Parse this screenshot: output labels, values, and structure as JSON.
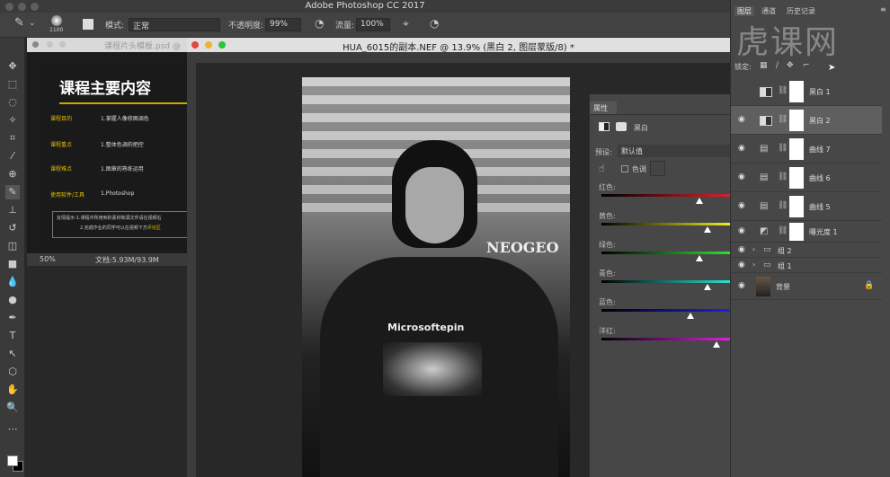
{
  "app": {
    "title": "Adobe Photoshop CC 2017"
  },
  "options": {
    "brush_size": "1100",
    "mode_label": "模式:",
    "mode_value": "正常",
    "opacity_label": "不透明度:",
    "opacity_value": "99%",
    "flow_label": "流量:",
    "flow_value": "100%"
  },
  "doc1": {
    "tab": "课程片头模板.psd @",
    "heading": "课程主要内容",
    "rows": [
      {
        "label": "课程目的",
        "value": "1.掌握人像修图调色"
      },
      {
        "label": "课程重点",
        "value": "1.整体色调的把控"
      },
      {
        "label": "课程难点",
        "value": "1.图章的熟练运用"
      },
      {
        "label": "使用软件/工具",
        "value": "1.Photoshop"
      }
    ],
    "tip1": "友情提示-1.课程中所用到的素材和源文件请在视频右",
    "tip2": "2.完成作业的同学可以在视频下方",
    "tip_highlight": "评论区",
    "zoom": "50%",
    "docsize": "文档:5.93M/93.9M"
  },
  "doc2": {
    "tab": "HUA_6015的副本.NEF @ 13.9% (黑白 2, 图层蒙版/8) *",
    "photo_text": "Microsoftepin",
    "sign_text": "NEOGEO"
  },
  "properties": {
    "tab": "属性",
    "type": "黑白",
    "preset_label": "预设:",
    "preset_value": "默认值",
    "tint_label": "色调",
    "sliders": [
      {
        "label": "红色:",
        "value": 0.76,
        "color": "#e0202a"
      },
      {
        "label": "黄色:",
        "value": 0.82,
        "color": "#f0f020"
      },
      {
        "label": "绿色:",
        "value": 0.76,
        "color": "#30e030"
      },
      {
        "label": "青色:",
        "value": 0.82,
        "color": "#30e0d0"
      },
      {
        "label": "蓝色:",
        "value": 0.69,
        "color": "#2020e0"
      },
      {
        "label": "洋红:",
        "value": 0.89,
        "color": "#e020e0"
      }
    ]
  },
  "layers": {
    "tabs": [
      "图层",
      "通道",
      "历史记录"
    ],
    "lock_label": "锁定:",
    "watermark": "虎课网",
    "items": [
      {
        "name": "黑白 1",
        "type": "bw",
        "visible": false
      },
      {
        "name": "黑白 2",
        "type": "bw",
        "visible": true,
        "selected": true
      },
      {
        "name": "曲线 7",
        "type": "curves",
        "visible": true
      },
      {
        "name": "曲线 6",
        "type": "curves",
        "visible": true
      },
      {
        "name": "曲线 5",
        "type": "curves",
        "visible": true
      },
      {
        "name": "曝光度 1",
        "type": "exposure",
        "visible": true
      },
      {
        "name": "组 2",
        "type": "group",
        "visible": true
      },
      {
        "name": "组 1",
        "type": "group",
        "visible": true
      },
      {
        "name": "背景",
        "type": "background",
        "visible": true
      }
    ]
  }
}
